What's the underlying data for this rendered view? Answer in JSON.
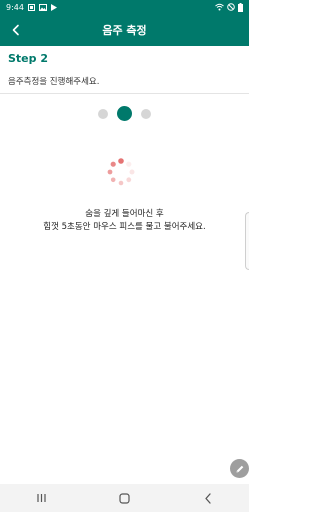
{
  "status_bar": {
    "time": "9:44"
  },
  "header": {
    "title": "음주 측정",
    "back_icon": "chevron-left-icon"
  },
  "step": {
    "title": "Step 2",
    "description": "음주측정을 진행해주세요."
  },
  "progress": {
    "total_steps": 3,
    "current_step": 2
  },
  "instruction": {
    "line1": "숨을 깊게 들어마신 후",
    "line2": "힘껏 5초동안 마우스 피스를 물고 불어주세요."
  },
  "colors": {
    "primary": "#00796b",
    "spinner": "#e57373",
    "dot_inactive": "#d6d6d6"
  },
  "nav": {
    "recents_icon": "recents-icon",
    "home_icon": "home-icon",
    "back_icon": "back-icon"
  },
  "fab": {
    "icon": "pencil-icon"
  }
}
